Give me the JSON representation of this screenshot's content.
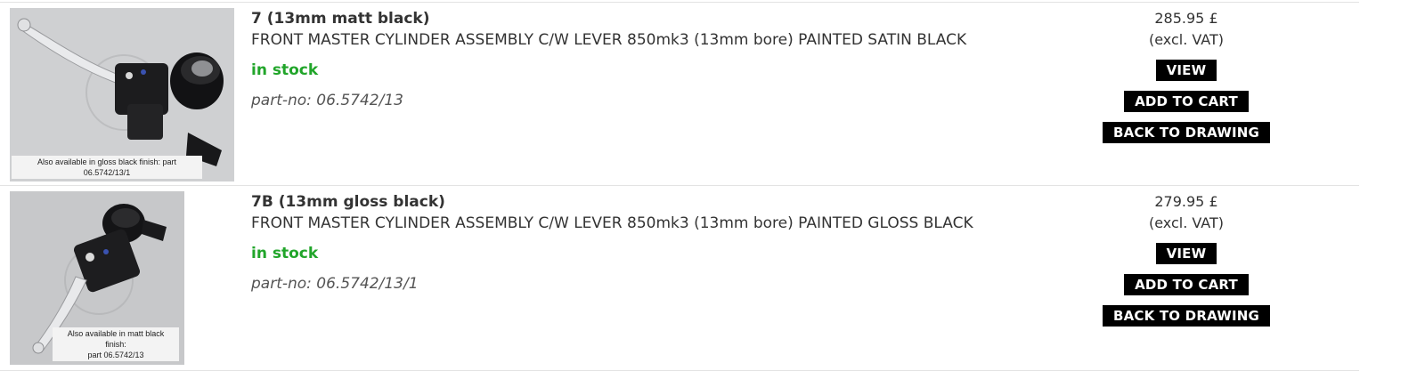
{
  "products": [
    {
      "title": "7 (13mm matt black)",
      "description": "FRONT MASTER CYLINDER ASSEMBLY C/W LEVER 850mk3 (13mm bore) PAINTED SATIN BLACK",
      "stock": "in stock",
      "part_no": "part-no: 06.5742/13",
      "price": "285.95 £",
      "vat_note": "(excl. VAT)",
      "image_caption": "Also available in gloss black finish: part 06.5742/13/1",
      "buttons": {
        "view": "VIEW",
        "add_to_cart": "ADD TO CART",
        "back_to_drawing": "BACK TO DRAWING"
      }
    },
    {
      "title": "7B (13mm gloss black)",
      "description": "FRONT MASTER CYLINDER ASSEMBLY C/W LEVER 850mk3 (13mm bore) PAINTED GLOSS BLACK",
      "stock": "in stock",
      "part_no": "part-no: 06.5742/13/1",
      "price": "279.95 £",
      "vat_note": "(excl. VAT)",
      "image_caption_line1": "Also available in matt black finish:",
      "image_caption_line2": "part 06.5742/13",
      "buttons": {
        "view": "VIEW",
        "add_to_cart": "ADD TO CART",
        "back_to_drawing": "BACK TO DRAWING"
      }
    }
  ],
  "colors": {
    "in_stock": "#21a52a",
    "button_bg": "#000000",
    "button_text": "#ffffff"
  }
}
